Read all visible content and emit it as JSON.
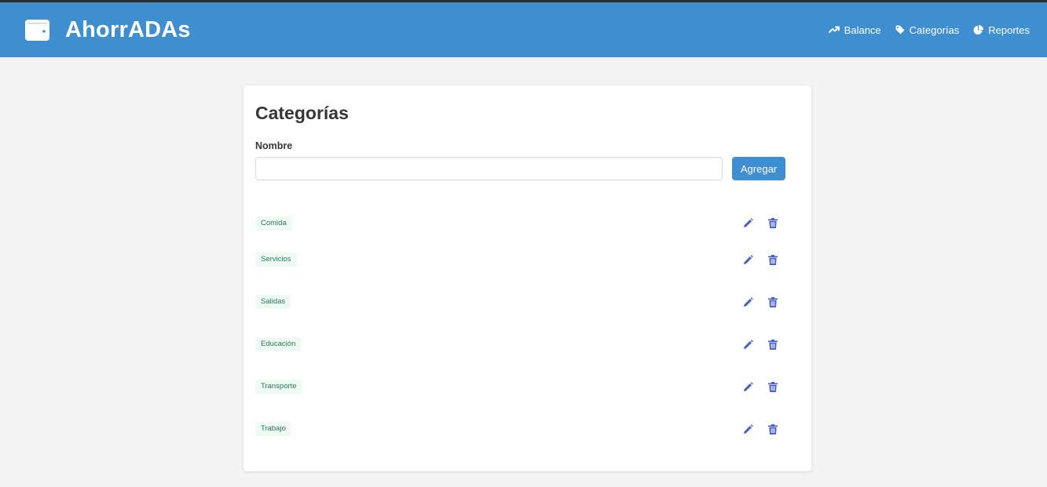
{
  "app": {
    "title": "AhorrADAs",
    "brand_icon": "wallet-icon"
  },
  "nav": {
    "items": [
      {
        "label": "Balance",
        "icon": "trending-up-icon"
      },
      {
        "label": "Categorías",
        "icon": "tag-icon"
      },
      {
        "label": "Reportes",
        "icon": "pie-chart-icon"
      }
    ]
  },
  "panel": {
    "title": "Categorías",
    "name_label": "Nombre",
    "name_value": "",
    "name_placeholder": "",
    "add_label": "Agregar"
  },
  "categories": [
    {
      "name": "Comida"
    },
    {
      "name": "Servicios"
    },
    {
      "name": "Salidas"
    },
    {
      "name": "Educación"
    },
    {
      "name": "Transporte"
    },
    {
      "name": "Trabajo"
    }
  ],
  "colors": {
    "primary": "#3e8ed0",
    "tag_bg": "#effaf5",
    "tag_text": "#257953",
    "action_icon": "#4a5fc8"
  }
}
